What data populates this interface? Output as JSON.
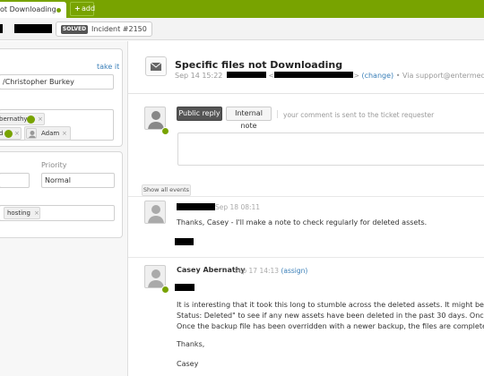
{
  "topbar": {
    "tab_title": "ot Downloading",
    "add_label": "add",
    "add_icon": "+"
  },
  "breadcrumb": {
    "status_badge": "SOLVED",
    "ticket_label": "Incident #2150"
  },
  "sidebar": {
    "take_it": "take it",
    "assignee_value": "/Christopher Burkey",
    "cc": [
      {
        "label": "bernathy",
        "remove": "×"
      },
      {
        "label": "d",
        "remove": "×"
      },
      {
        "label": "Adam",
        "remove": "×"
      }
    ],
    "priority_label": "Priority",
    "priority_value": "Normal",
    "tags": [
      {
        "label": "hosting",
        "remove": "×"
      }
    ]
  },
  "ticket": {
    "subject": "Specific files not Downloading",
    "date": "Sep 14 15:22",
    "separator_1": "<",
    "separator_2": ">",
    "change_link": "(change)",
    "bullet": "•",
    "via": "Via support@entermedia"
  },
  "composer": {
    "public_reply": "Public reply",
    "internal_note": "Internal note",
    "hint": "your comment is sent to the ticket requester"
  },
  "events": {
    "show_all": "Show all events",
    "comments": [
      {
        "timestamp": "Sep 18 08:11",
        "body": [
          "Thanks, Casey - I'll make a note to check regularly for deleted assets."
        ]
      },
      {
        "author": "Casey Abernathy",
        "timestamp": "Sep 17 14:13",
        "assign": "(assign)",
        "body": [
          "It is interesting that it took this long to stumble across the deleted assets. It might be worth ch",
          "Status: Deleted\" to see if any new assets have been deleted in the past 30 days. Once assets ha",
          "Once the backup file has been overridden with a newer backup, the files are completely unavail",
          "Thanks,",
          "Casey"
        ]
      }
    ]
  },
  "colors": {
    "brand_green": "#78a300",
    "link_blue": "#3a7fb8",
    "dark_button": "#555555"
  }
}
